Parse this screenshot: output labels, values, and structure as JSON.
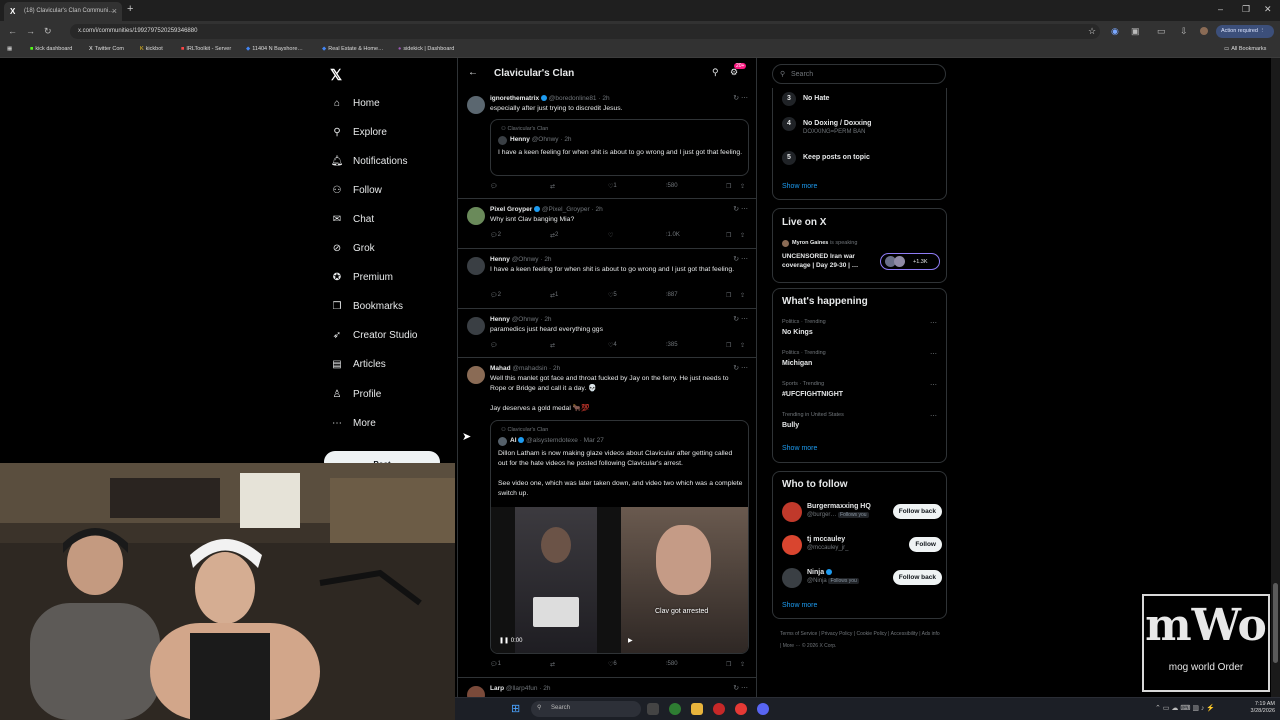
{
  "browser": {
    "tab_title": "(18) Clavicular's Clan Communi…",
    "url": "x.com/i/communities/1992797520259346880",
    "action_required": "Action required",
    "bookmarks": [
      "kick dashboard",
      "Twitter Com",
      "kickbot",
      "IRLToolkit - Server",
      "11404 N Bayshore…",
      "Real Estate & Home…",
      "sidekick | Dashboard"
    ],
    "all_bookmarks": "All Bookmarks"
  },
  "nav": {
    "items": [
      {
        "label": "Home",
        "icon": "home-icon"
      },
      {
        "label": "Explore",
        "icon": "search-icon"
      },
      {
        "label": "Notifications",
        "icon": "bell-icon"
      },
      {
        "label": "Follow",
        "icon": "follow-icon"
      },
      {
        "label": "Chat",
        "icon": "mail-icon"
      },
      {
        "label": "Grok",
        "icon": "grok-icon"
      },
      {
        "label": "Premium",
        "icon": "premium-icon"
      },
      {
        "label": "Bookmarks",
        "icon": "bookmark-icon"
      },
      {
        "label": "Creator Studio",
        "icon": "rocket-icon"
      },
      {
        "label": "Articles",
        "icon": "articles-icon"
      },
      {
        "label": "Profile",
        "icon": "profile-icon"
      },
      {
        "label": "More",
        "icon": "more-icon"
      }
    ],
    "post_label": "Post"
  },
  "feed": {
    "title": "Clavicular's Clan",
    "badge": "20+",
    "posts": [
      {
        "name": "ignorethematrix",
        "handle": "@boredonline81",
        "time": "2h",
        "text": "especially after just trying to discredit Jesus.",
        "quote": {
          "community": "Clavicular's Clan",
          "name": "Henny",
          "handle": "@Ohnwy",
          "time": "2h",
          "text": "I have a keen feeling for when shit is about to go wrong and I just got that feeling."
        },
        "replies": "",
        "reposts": "",
        "likes": "1",
        "views": "580"
      },
      {
        "name": "Pixel Groyper",
        "handle": "@Pixel_Groyper",
        "time": "2h",
        "text": "Why isnt Clav banging Mia?",
        "replies": "2",
        "reposts": "2",
        "likes": "",
        "views": "1.0K"
      },
      {
        "name": "Henny",
        "handle": "@Ohnwy",
        "time": "2h",
        "text": "I have a keen feeling for when shit is about to go wrong and I just got that feeling.",
        "replies": "2",
        "reposts": "1",
        "likes": "5",
        "views": "887"
      },
      {
        "name": "Henny",
        "handle": "@Ohnwy",
        "time": "2h",
        "text": "paramedics just heard everything ggs",
        "replies": "",
        "reposts": "",
        "likes": "4",
        "views": "385"
      },
      {
        "name": "Mahad",
        "handle": "@mahadsin",
        "time": "2h",
        "text": "Well this manlet got face and throat fucked by Jay on the ferry. He just needs to Rope or Bridge and call it a day. 💀",
        "text2": "Jay deserves a gold medal 🐂💯",
        "quote": {
          "community": "Clavicular's Clan",
          "name": "Al",
          "handle": "@alsystemdotexe",
          "time": "Mar 27",
          "text": "Dillon Latham is now making glaze videos about Clavicular after getting called out for the hate videos he posted following Clavicular's arrest.",
          "text2": "See video one, which was later taken down, and video two which was a complete switch up.",
          "video_time": "0:00",
          "video_caption": "Clav got arrested"
        },
        "replies": "1",
        "reposts": "",
        "likes": "6",
        "views": "580"
      },
      {
        "name": "Larp",
        "handle": "@llarp4fun",
        "time": "2h"
      }
    ]
  },
  "right": {
    "search_placeholder": "Search",
    "rules": [
      {
        "num": "3",
        "title": "No Hate",
        "sub": ""
      },
      {
        "num": "4",
        "title": "No Doxing / Doxxing",
        "sub": "DOXXING=PERM BAN"
      },
      {
        "num": "5",
        "title": "Keep posts on topic",
        "sub": ""
      }
    ],
    "show_more": "Show more",
    "live": {
      "title": "Live on X",
      "host": "Myron Gaines",
      "host_suffix": "is speaking",
      "stream": "UNCENSORED Iran war coverage | Day 29-30 | …",
      "count": "+1.3K"
    },
    "happening_title": "What's happening",
    "trends": [
      {
        "meta": "Politics · Trending",
        "name": "No Kings"
      },
      {
        "meta": "Politics · Trending",
        "name": "Michigan"
      },
      {
        "meta": "Sports · Trending",
        "name": "#UFCFIGHTNIGHT"
      },
      {
        "meta": "Trending in United States",
        "name": "Bully"
      }
    ],
    "who_title": "Who to follow",
    "who": [
      {
        "name": "Burgermaxxing HQ",
        "handle": "@burger…",
        "follows_you": "Follows you",
        "button": "Follow back",
        "color": "#c0392b"
      },
      {
        "name": "tj mccauley",
        "handle": "@mccauley_jr_",
        "follows_you": "",
        "button": "Follow",
        "color": "#c0392b"
      },
      {
        "name": "Ninja",
        "handle": "@Ninja",
        "follows_you": "Follows you",
        "button": "Follow back",
        "color": "#3a3f44"
      }
    ],
    "footer": "Terms of Service  |  Privacy Policy  |  Cookie Policy  |  Accessibility  |  Ads info  |  More ···  © 2026 X Corp."
  },
  "taskbar": {
    "search": "Search",
    "time": "7:19 AM",
    "date": "3/28/2026"
  },
  "overlay": {
    "logo_top": "mWo",
    "logo_bottom": "mog world Order"
  }
}
